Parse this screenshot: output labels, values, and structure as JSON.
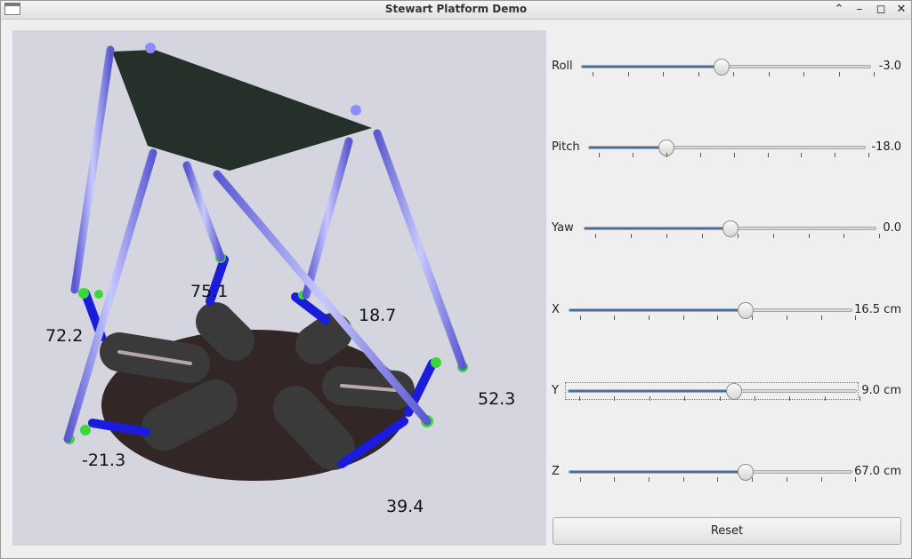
{
  "window": {
    "title": "Stewart Platform Demo"
  },
  "viewport": {
    "leg_lengths": [
      "75.1",
      "18.7",
      "72.2",
      "52.3",
      "-21.3",
      "39.4"
    ]
  },
  "sliders": [
    {
      "label": "Roll",
      "value_text": "-3.0",
      "fraction": 0.485
    },
    {
      "label": "Pitch",
      "value_text": "-18.0",
      "fraction": 0.28
    },
    {
      "label": "Yaw",
      "value_text": "0.0",
      "fraction": 0.5
    },
    {
      "label": "X",
      "value_text": "16.5 cm",
      "fraction": 0.625
    },
    {
      "label": "Y",
      "value_text": "9.0 cm",
      "fraction": 0.575
    },
    {
      "label": "Z",
      "value_text": "67.0 cm",
      "fraction": 0.625
    }
  ],
  "reset_label": "Reset"
}
